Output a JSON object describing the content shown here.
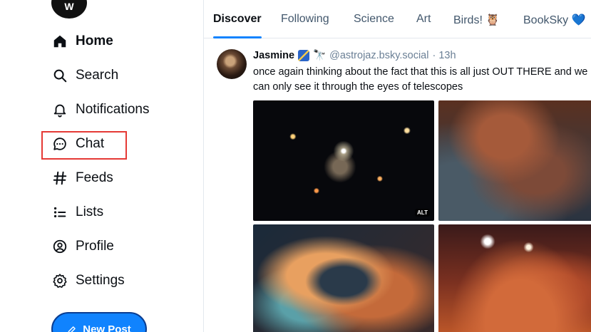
{
  "app": {
    "logo_letter": "W"
  },
  "sidebar": {
    "items": [
      {
        "label": "Home",
        "icon": "home-icon",
        "active": true
      },
      {
        "label": "Search",
        "icon": "search-icon"
      },
      {
        "label": "Notifications",
        "icon": "bell-icon"
      },
      {
        "label": "Chat",
        "icon": "chat-bubble-icon",
        "highlighted": true
      },
      {
        "label": "Feeds",
        "icon": "hash-icon"
      },
      {
        "label": "Lists",
        "icon": "list-icon"
      },
      {
        "label": "Profile",
        "icon": "user-circle-icon"
      },
      {
        "label": "Settings",
        "icon": "gear-icon"
      }
    ],
    "new_post_label": "New Post"
  },
  "tabs": [
    {
      "label": "Discover",
      "active": true
    },
    {
      "label": "Following"
    },
    {
      "label": "Science"
    },
    {
      "label": "Art"
    },
    {
      "label": "Birds! 🦉"
    },
    {
      "label": "BookSky 💙"
    }
  ],
  "post": {
    "author": "Jasmine",
    "badge_emoji": "🔭",
    "handle": "@astrojaz.bsky.social",
    "time": "· 13h",
    "text_line1": "once again thinking about the fact that this is all just OUT THERE and we",
    "text_line2": "can only see it through the eyes of telescopes",
    "alt_label": "ALT"
  },
  "colors": {
    "accent": "#1083fe",
    "highlight_border": "#e53935",
    "text": "#0b0f14",
    "muted": "#42576c"
  }
}
